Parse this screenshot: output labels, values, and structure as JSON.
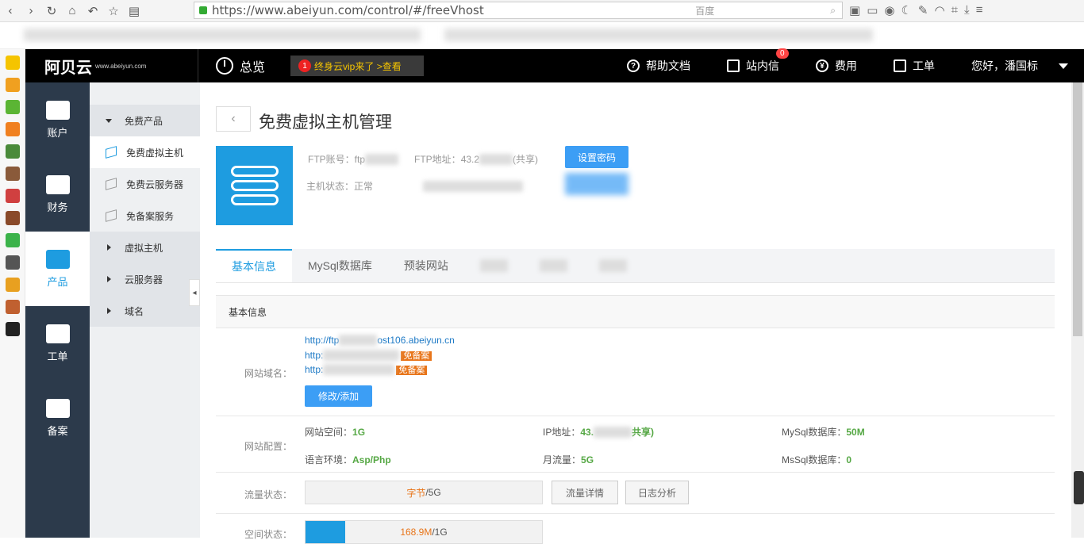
{
  "browser": {
    "url_prefix": "https://www.abeiyun.com/control/#/freeVhost",
    "search_engine": "百度"
  },
  "brand": {
    "logo_text": "阿贝云",
    "logo_sub": "www.abeiyun.com"
  },
  "topnav": {
    "overview": "总览",
    "promo_badge": "1",
    "promo_text": "终身云vip来了 >查看",
    "help": "帮助文档",
    "messages": "站内信",
    "message_count": "0",
    "fees": "费用",
    "tickets": "工单",
    "user_greeting": "您好，潘国标"
  },
  "sidebar": {
    "items": [
      {
        "label": "账户"
      },
      {
        "label": "财务"
      },
      {
        "label": "产品"
      },
      {
        "label": "工单"
      },
      {
        "label": "备案"
      }
    ]
  },
  "submenu": {
    "items": [
      {
        "label": "免费产品"
      },
      {
        "label": "免费虚拟主机"
      },
      {
        "label": "免费云服务器"
      },
      {
        "label": "免备案服务"
      },
      {
        "label": "虚拟主机"
      },
      {
        "label": "云服务器"
      },
      {
        "label": "域名"
      }
    ]
  },
  "page": {
    "title": "免费虚拟主机管理",
    "ftp_account_label": "FTP账号：",
    "ftp_account_value": "ftp",
    "ftp_address_label": "FTP地址：",
    "ftp_address_value": "43.2",
    "ftp_address_suffix": "(共享)",
    "set_password": "设置密码",
    "host_status_label": "主机状态：",
    "host_status_value": "正常"
  },
  "tabs": [
    {
      "label": "基本信息"
    },
    {
      "label": "MySql数据库"
    },
    {
      "label": "预装网站"
    }
  ],
  "basic_info": {
    "section_title": "基本信息",
    "domain_label": "网站域名：",
    "domains": [
      {
        "prefix": "http://ftp",
        "suffix": "ost106.abeiyun.cn",
        "badge": ""
      },
      {
        "prefix": "http:",
        "suffix": "",
        "badge": "免备案"
      },
      {
        "prefix": "http:",
        "suffix": "",
        "badge": "免备案"
      }
    ],
    "modify_button": "修改/添加",
    "config_label": "网站配置：",
    "space_label": "网站空间：",
    "space_value": "1G",
    "ip_label": "IP地址：",
    "ip_value": "43.",
    "ip_suffix": "共享)",
    "mysql_label": "MySql数据库：",
    "mysql_value": "50M",
    "lang_label": "语言环境：",
    "lang_value": "Asp/Php",
    "traffic_label": "月流量：",
    "traffic_value": "5G",
    "mssql_label": "MsSql数据库：",
    "mssql_value": "0",
    "traffic_status_label": "流量状态：",
    "traffic_used": "字节",
    "traffic_total": "/5G",
    "traffic_detail": "流量详情",
    "log_analysis": "日志分析",
    "space_status_label": "空间状态：",
    "space_used": "168.9M",
    "space_total": "/1G",
    "space_fraction": 0.169
  }
}
